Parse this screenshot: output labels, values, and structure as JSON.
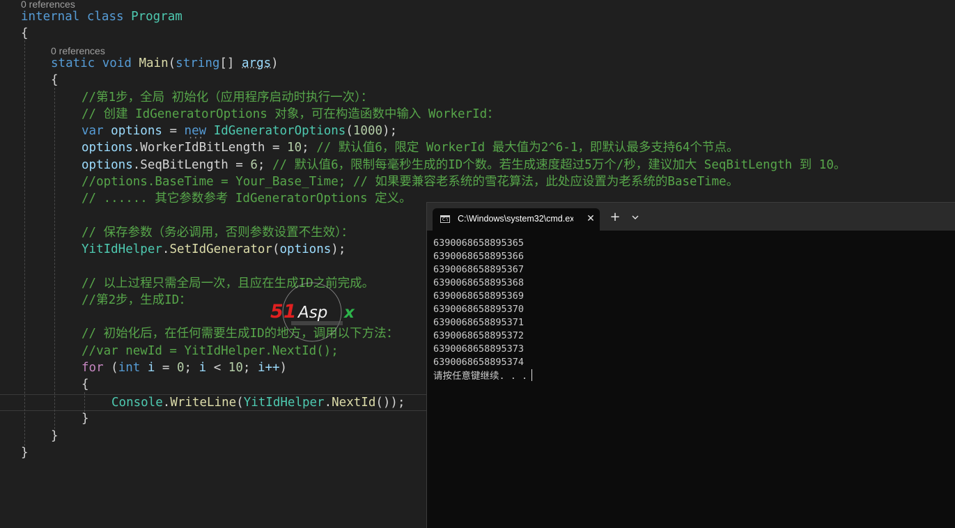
{
  "editor": {
    "class_lens": "0 references",
    "class_decl": [
      "internal",
      "class",
      "Program"
    ],
    "method_lens": "0 references",
    "method_decl": {
      "static": "static",
      "void": "void",
      "name": "Main",
      "type": "string",
      "brackets": "[]",
      "param": "args"
    },
    "open_brace": "{",
    "close_brace": "}",
    "comment_step1": "//第1步，全局 初始化（应用程序启动时执行一次）：",
    "comment_create": "// 创建 IdGeneratorOptions 对象，可在构造函数中输入 WorkerId：",
    "line_var": {
      "kw": "var",
      "name": "options",
      "eq": " = ",
      "new": "new",
      "type": "IdGeneratorOptions",
      "arg": "1000"
    },
    "line_worker": {
      "obj": "options",
      "prop": ".WorkerIdBitLength = ",
      "val": "10",
      "comment": "// 默认值6，限定 WorkerId 最大值为2^6-1，即默认最多支持64个节点。"
    },
    "line_seq": {
      "obj": "options",
      "prop": ".SeqBitLength = ",
      "val": "6",
      "comment": "// 默认值6，限制每毫秒生成的ID个数。若生成速度超过5万个/秒，建议加大 SeqBitLength 到 10。"
    },
    "comment_basetime": "//options.BaseTime = Your_Base_Time; // 如果要兼容老系统的雪花算法，此处应设置为老系统的BaseTime。",
    "comment_other": "// ...... 其它参数参考 IdGeneratorOptions 定义。",
    "comment_save": "// 保存参数（务必调用，否则参数设置不生效）：",
    "line_set": {
      "type": "YitIdHelper",
      "method": "SetIdGenerator",
      "arg": "options"
    },
    "comment_once": "// 以上过程只需全局一次，且应在生成ID之前完成。",
    "comment_step2": "//第2步，生成ID：",
    "comment_init": "// 初始化后，在任何需要生成ID的地方，调用以下方法：",
    "comment_newid": "//var newId = YitIdHelper.NextId();",
    "line_for": {
      "for": "for",
      "int": "int",
      "i": "i",
      "eq": " = ",
      "zero": "0",
      "lt": " < ",
      "ten": "10",
      "inc": "i++"
    },
    "line_console": {
      "type": "Console",
      "method": "WriteLine",
      "type2": "YitIdHelper",
      "method2": "NextId"
    }
  },
  "terminal": {
    "tab_title": "C:\\Windows\\system32\\cmd.exe",
    "icon_text": "C:\\",
    "close_symbol": "✕",
    "new_tab_symbol": "+",
    "output": [
      "6390068658895365",
      "6390068658895366",
      "6390068658895367",
      "6390068658895368",
      "6390068658895369",
      "6390068658895370",
      "6390068658895371",
      "6390068658895372",
      "6390068658895373",
      "6390068658895374"
    ],
    "prompt": "请按任意键继续. . ."
  },
  "watermark": {
    "logo_text": "51Aspx",
    "colors": {
      "red": "#e02020",
      "green": "#2db34a",
      "white": "#f0f0f0"
    }
  }
}
